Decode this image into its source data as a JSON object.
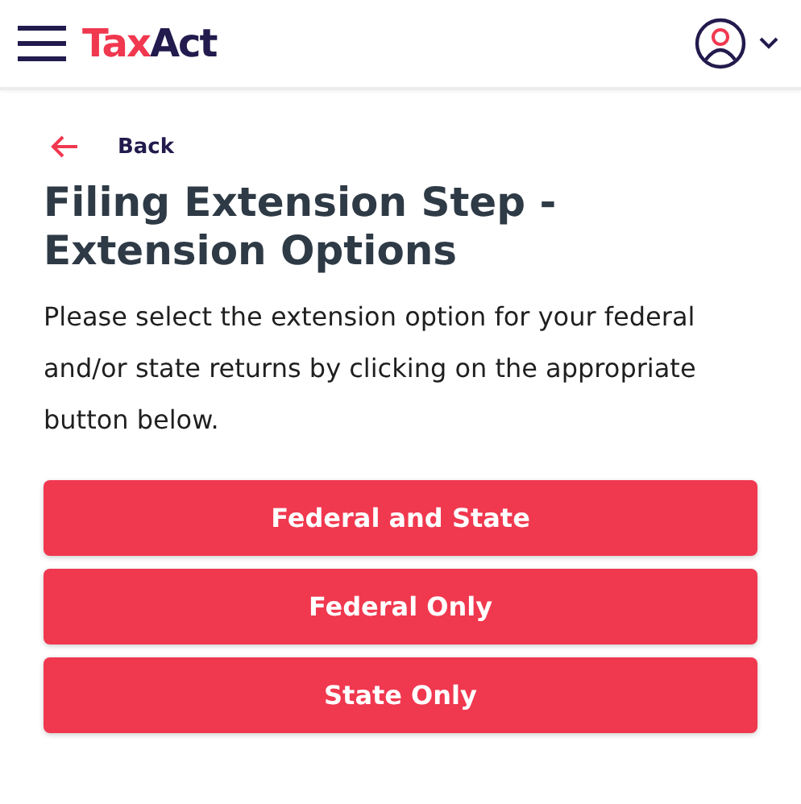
{
  "header": {
    "logo": {
      "part_1": "Tax",
      "part_2": "Act"
    }
  },
  "back_link": {
    "label": "Back"
  },
  "title": "Filing Extension Step - Extension Options",
  "description": "Please select the extension option for your federal and/or state returns by clicking on the appropriate button below.",
  "buttons": [
    {
      "label": "Federal and State"
    },
    {
      "label": "Federal Only"
    },
    {
      "label": "State Only"
    }
  ]
}
